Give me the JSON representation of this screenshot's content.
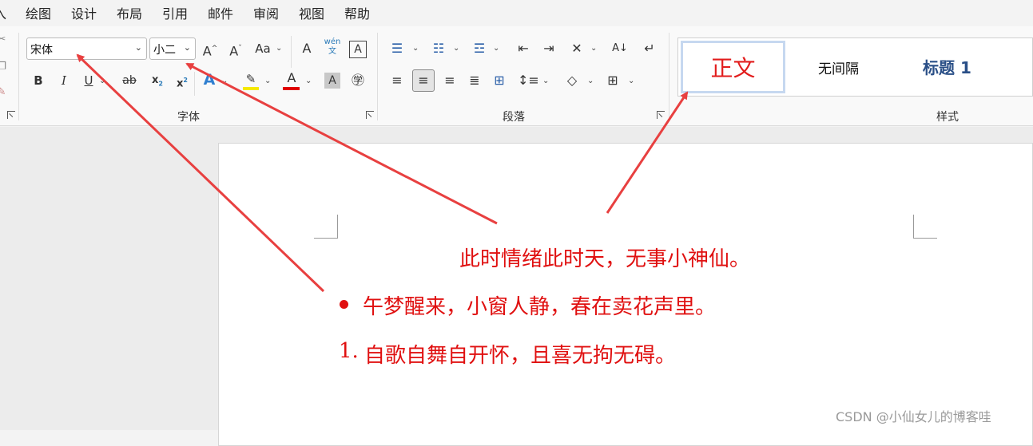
{
  "menu": [
    "入",
    "绘图",
    "设计",
    "布局",
    "引用",
    "邮件",
    "审阅",
    "视图",
    "帮助"
  ],
  "ribbon": {
    "font_name": "宋体",
    "font_size": "小二",
    "groups": {
      "font": "字体",
      "paragraph": "段落",
      "styles": "样式"
    },
    "styles": {
      "normal": "正文",
      "no_spacing": "无间隔",
      "heading1": "标题 1"
    },
    "font_buttons": {
      "bold": "B",
      "italic": "I",
      "underline": "U",
      "strike": "ab",
      "subscript": "x₂",
      "superscript": "x²",
      "change_case": "Aa",
      "clear": "A",
      "phonetic": "wén",
      "charborder": "A"
    }
  },
  "document": {
    "line1": "此时情绪此时天，无事小神仙。",
    "line2": "午梦醒来，小窗人静，春在卖花声里。",
    "line3_number": "1.",
    "line3": "自歌自舞自开怀，且喜无拘无碍。",
    "text_color": "#e01010"
  },
  "watermark": "CSDN @小仙女儿的博客哇",
  "annotation_color": "#e84040"
}
